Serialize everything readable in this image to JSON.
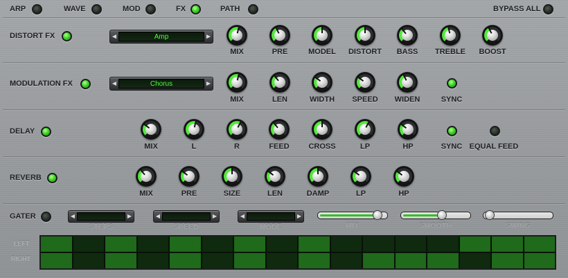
{
  "top_nav": [
    {
      "label": "ARP",
      "on": false
    },
    {
      "label": "WAVE",
      "on": false
    },
    {
      "label": "MOD",
      "on": false
    },
    {
      "label": "FX",
      "on": true
    },
    {
      "label": "PATH",
      "on": false
    }
  ],
  "bypass_all": {
    "label": "BYPASS ALL",
    "on": false
  },
  "distort": {
    "title": "DISTORT FX",
    "enabled": true,
    "preset": "Amp",
    "knobs": [
      {
        "label": "MIX",
        "value": 0.55
      },
      {
        "label": "PRE",
        "value": 0.4
      },
      {
        "label": "MODEL",
        "value": 0.5
      },
      {
        "label": "DISTORT",
        "value": 0.5
      },
      {
        "label": "BASS",
        "value": 0.35
      },
      {
        "label": "TREBLE",
        "value": 0.45
      },
      {
        "label": "BOOST",
        "value": 0.4
      }
    ]
  },
  "modulation": {
    "title": "MODULATION FX",
    "enabled": true,
    "preset": "Chorus",
    "knobs": [
      {
        "label": "MIX",
        "value": 0.55
      },
      {
        "label": "LEN",
        "value": 0.35
      },
      {
        "label": "WIDTH",
        "value": 0.3
      },
      {
        "label": "SPEED",
        "value": 0.3
      },
      {
        "label": "WIDEN",
        "value": 0.4
      }
    ],
    "sync": {
      "label": "SYNC",
      "on": true
    }
  },
  "delay": {
    "title": "DELAY",
    "enabled": true,
    "knobs": [
      {
        "label": "MIX",
        "value": 0.3
      },
      {
        "label": "L",
        "value": 0.55
      },
      {
        "label": "R",
        "value": 0.6
      },
      {
        "label": "FEED",
        "value": 0.35
      },
      {
        "label": "CROSS",
        "value": 0.5
      },
      {
        "label": "LP",
        "value": 0.6
      },
      {
        "label": "HP",
        "value": 0.3
      }
    ],
    "sync": {
      "label": "SYNC",
      "on": true
    },
    "equal_feed": {
      "label": "EQUAL FEED",
      "on": false
    }
  },
  "reverb": {
    "title": "REVERB",
    "enabled": true,
    "knobs": [
      {
        "label": "MIX",
        "value": 0.35
      },
      {
        "label": "PRE",
        "value": 0.3
      },
      {
        "label": "SIZE",
        "value": 0.5
      },
      {
        "label": "LEN",
        "value": 0.3
      },
      {
        "label": "DAMP",
        "value": 0.5
      },
      {
        "label": "LP",
        "value": 0.3
      },
      {
        "label": "HP",
        "value": 0.3
      }
    ]
  },
  "gater": {
    "title": "GATER",
    "enabled": false,
    "steps_label": "STEPS",
    "speed_label": "SPEED",
    "mode_label": "MODE",
    "mix_label": "MIX",
    "mix_value": 0.92,
    "smooth_label": "SMOOTH",
    "smooth_value": 0.6,
    "swing_label": "SWING",
    "swing_value": 0.0,
    "row_left": "LEFT",
    "row_right": "RIGHT",
    "pattern_left": [
      1,
      0,
      1,
      0,
      1,
      0,
      1,
      0,
      1,
      0,
      0,
      0,
      0,
      1,
      1,
      1
    ],
    "pattern_right": [
      1,
      0,
      1,
      0,
      1,
      0,
      1,
      0,
      1,
      0,
      1,
      1,
      1,
      0,
      1,
      1
    ]
  },
  "colors": {
    "accent": "#52e83a",
    "panel": "#9a9da0"
  }
}
